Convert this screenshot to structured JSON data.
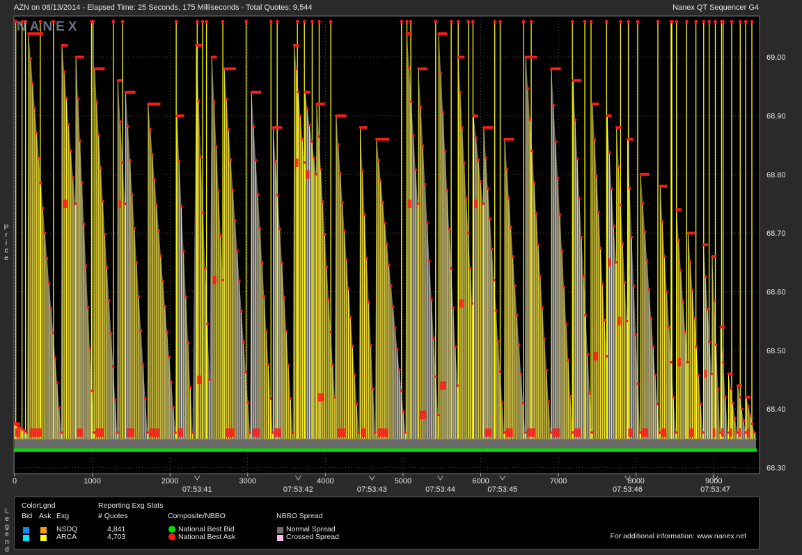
{
  "header": {
    "left": "AZN on 08/13/2014  -  Elapsed Time: 25 Seconds, 175 Milliseconds  -  Total Quotes: 9,544",
    "right": "Nanex QT Sequencer G4"
  },
  "watermark": "NANEX",
  "side_labels": {
    "price": "Price",
    "legend": "Legend"
  },
  "chart_data": {
    "type": "line",
    "title": "AZN on 08/13/2014",
    "ylabel": "Price",
    "xlim": [
      0,
      9544
    ],
    "ylim": [
      68.29,
      69.07
    ],
    "y_ticks": [
      "69.00",
      "68.90",
      "68.80",
      "68.70",
      "68.60",
      "68.50",
      "68.40",
      "68.30"
    ],
    "x_ticks": [
      "0",
      "1000",
      "2000",
      "3000",
      "4000",
      "5000",
      "6000",
      "7000",
      "8000",
      "9000"
    ],
    "time_ticks": [
      {
        "quote": 2350,
        "label": "07:53:41"
      },
      {
        "quote": 3650,
        "label": "07:53:42"
      },
      {
        "quote": 4600,
        "label": "07:53:43"
      },
      {
        "quote": 5480,
        "label": "07:53:44"
      },
      {
        "quote": 6280,
        "label": "07:53:45"
      },
      {
        "quote": 7890,
        "label": "07:53:46"
      },
      {
        "quote": 9020,
        "label": "07:53:47"
      }
    ],
    "series": [
      {
        "name": "National Best Bid",
        "color": "#00e000",
        "value": 68.33
      },
      {
        "name": "National Best Ask",
        "color": "#ff1a1a",
        "cycles": [
          {
            "start": 0,
            "end": 160,
            "top": 68.375,
            "low": 68.36
          },
          {
            "start": 180,
            "end": 600,
            "top": 69.04,
            "low": 68.36
          },
          {
            "start": 610,
            "end": 780,
            "top": 69.02,
            "low": 68.75
          },
          {
            "start": 790,
            "end": 1020,
            "top": 69.0,
            "low": 68.36
          },
          {
            "start": 1030,
            "end": 1320,
            "top": 68.98,
            "low": 68.36
          },
          {
            "start": 1330,
            "end": 1420,
            "top": 68.96,
            "low": 68.75
          },
          {
            "start": 1430,
            "end": 1710,
            "top": 68.94,
            "low": 68.36
          },
          {
            "start": 1720,
            "end": 2070,
            "top": 68.92,
            "low": 68.36
          },
          {
            "start": 2090,
            "end": 2290,
            "top": 68.9,
            "low": 68.36
          },
          {
            "start": 2340,
            "end": 2510,
            "top": 69.02,
            "low": 68.45
          },
          {
            "start": 2540,
            "end": 2680,
            "top": 69.0,
            "low": 68.62
          },
          {
            "start": 2700,
            "end": 3030,
            "top": 68.98,
            "low": 68.36
          },
          {
            "start": 3050,
            "end": 3320,
            "top": 68.94,
            "low": 68.36
          },
          {
            "start": 3330,
            "end": 3580,
            "top": 68.88,
            "low": 68.36
          },
          {
            "start": 3600,
            "end": 3730,
            "top": 69.02,
            "low": 68.82
          },
          {
            "start": 3740,
            "end": 3880,
            "top": 68.94,
            "low": 68.8
          },
          {
            "start": 3890,
            "end": 4120,
            "top": 68.92,
            "low": 68.42
          },
          {
            "start": 4140,
            "end": 4430,
            "top": 68.9,
            "low": 68.36
          },
          {
            "start": 4450,
            "end": 4640,
            "top": 68.88,
            "low": 68.36
          },
          {
            "start": 4660,
            "end": 5030,
            "top": 68.86,
            "low": 68.36
          },
          {
            "start": 5050,
            "end": 5190,
            "top": 69.04,
            "low": 68.75
          },
          {
            "start": 5200,
            "end": 5450,
            "top": 68.98,
            "low": 68.39
          },
          {
            "start": 5460,
            "end": 5700,
            "top": 69.04,
            "low": 68.44
          },
          {
            "start": 5710,
            "end": 5890,
            "top": 69.0,
            "low": 68.58
          },
          {
            "start": 5910,
            "end": 6030,
            "top": 68.9,
            "low": 68.75
          },
          {
            "start": 6040,
            "end": 6300,
            "top": 68.88,
            "low": 68.36
          },
          {
            "start": 6310,
            "end": 6570,
            "top": 68.86,
            "low": 68.36
          },
          {
            "start": 6580,
            "end": 6900,
            "top": 69.0,
            "low": 68.36
          },
          {
            "start": 6910,
            "end": 7180,
            "top": 68.98,
            "low": 68.36
          },
          {
            "start": 7190,
            "end": 7430,
            "top": 68.96,
            "low": 68.36
          },
          {
            "start": 7440,
            "end": 7620,
            "top": 68.92,
            "low": 68.49
          },
          {
            "start": 7630,
            "end": 7740,
            "top": 68.9,
            "low": 68.65
          },
          {
            "start": 7750,
            "end": 7880,
            "top": 68.88,
            "low": 68.55
          },
          {
            "start": 7890,
            "end": 8050,
            "top": 68.86,
            "low": 68.36
          },
          {
            "start": 8060,
            "end": 8300,
            "top": 68.8,
            "low": 68.36
          },
          {
            "start": 8310,
            "end": 8510,
            "top": 68.78,
            "low": 68.36
          },
          {
            "start": 8520,
            "end": 8660,
            "top": 68.74,
            "low": 68.48
          },
          {
            "start": 8670,
            "end": 8860,
            "top": 68.7,
            "low": 68.36
          },
          {
            "start": 8870,
            "end": 8970,
            "top": 68.68,
            "low": 68.46
          },
          {
            "start": 8980,
            "end": 9080,
            "top": 68.66,
            "low": 68.36
          },
          {
            "start": 9090,
            "end": 9180,
            "top": 68.54,
            "low": 68.36
          },
          {
            "start": 9190,
            "end": 9300,
            "top": 68.46,
            "low": 68.36
          },
          {
            "start": 9310,
            "end": 9410,
            "top": 68.44,
            "low": 68.36
          },
          {
            "start": 9420,
            "end": 9520,
            "top": 68.42,
            "low": 68.36
          }
        ]
      }
    ],
    "spikes_x": [
      15,
      95,
      140,
      330,
      500,
      990,
      1010,
      1270,
      1390,
      2080,
      2350,
      2420,
      2470,
      2680,
      2980,
      3300,
      3380,
      3640,
      3730,
      3830,
      3920,
      4070,
      4980,
      5050,
      5100,
      5420,
      5620,
      5710,
      5840,
      5900,
      6180,
      6250,
      6550,
      6650,
      7180,
      7340,
      7420,
      7620,
      7800,
      7900,
      8020,
      8280,
      8450,
      8460,
      8520,
      8650,
      8770,
      8870,
      8940,
      9020,
      9100,
      9120,
      9230,
      9340,
      9410,
      9490
    ]
  },
  "legend": {
    "color_title": "ColorLgnd",
    "col_bid": "Bid",
    "col_ask": "Ask",
    "col_exg": "Exg",
    "stats_title": "Reporting Exg Stats",
    "quotes_header": "# Quotes",
    "composite_header": "Composite/NBBO",
    "spread_header": "NBBO Spread",
    "exchanges": [
      {
        "name": "NSDQ",
        "quotes": "4,841",
        "bid_color": "#0a8cff",
        "ask_color": "#ff9900"
      },
      {
        "name": "ARCA",
        "quotes": "4,703",
        "bid_color": "#00e5ff",
        "ask_color": "#ffff00"
      }
    ],
    "composite": [
      {
        "label": "National Best Bid",
        "color": "#00e000"
      },
      {
        "label": "National Best Ask",
        "color": "#ff1a1a"
      }
    ],
    "spread": [
      {
        "label": "Normal Spread",
        "color": "#6e6e6e"
      },
      {
        "label": "Crossed Spread",
        "color": "#ffbbee"
      }
    ],
    "footer": "For additional information: www.nanex.net"
  }
}
